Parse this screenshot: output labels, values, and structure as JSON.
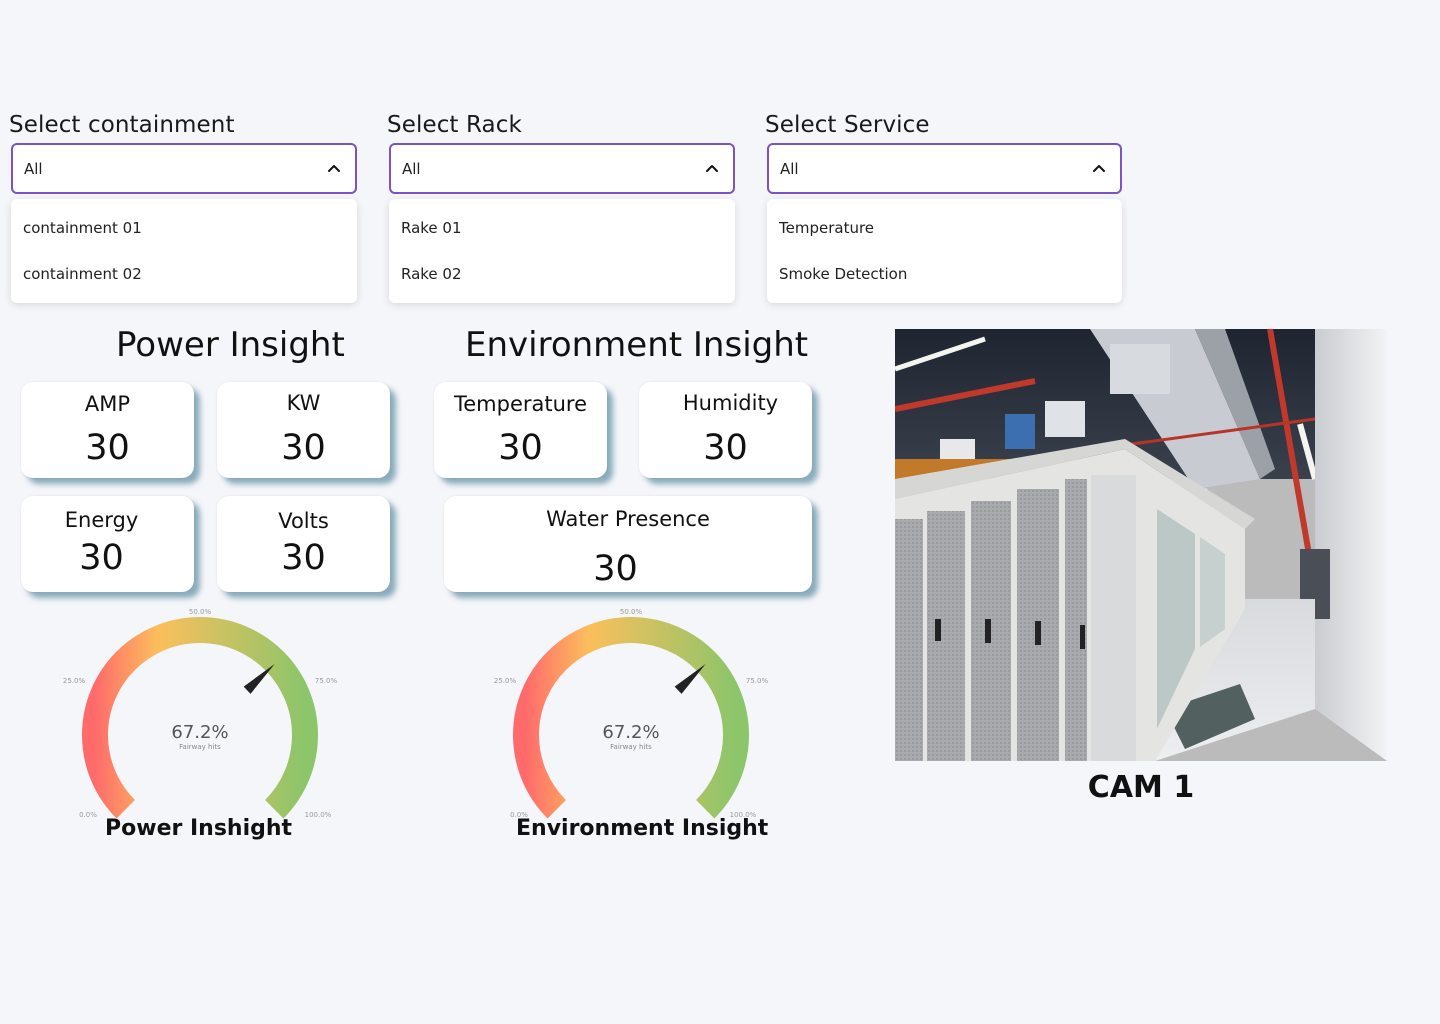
{
  "filters": [
    {
      "label": "Select containment",
      "value": "All",
      "options": [
        "containment 01",
        "containment 02"
      ]
    },
    {
      "label": "Select Rack",
      "value": "All",
      "options": [
        "Rake 01",
        "Rake 02"
      ]
    },
    {
      "label": "Select Service",
      "value": "All",
      "options": [
        "Temperature",
        "Smoke Detection"
      ]
    }
  ],
  "power": {
    "title": "Power Insight",
    "cards": [
      {
        "label": "AMP",
        "value": "30"
      },
      {
        "label": "KW",
        "value": "30"
      },
      {
        "label": "Energy",
        "value": "30"
      },
      {
        "label": "Volts",
        "value": "30"
      }
    ]
  },
  "environment": {
    "title": "Environment Insight",
    "cards": [
      {
        "label": "Temperature",
        "value": "30"
      },
      {
        "label": "Humidity",
        "value": "30"
      },
      {
        "label": "Water Presence",
        "value": "30"
      }
    ]
  },
  "gauges": [
    {
      "caption": "Power Inshight",
      "value_text": "67.2%",
      "sub_label": "Fairway hits",
      "value_fraction": 0.672,
      "ticks": {
        "t0": "0.0%",
        "t25": "25.0%",
        "t50": "50.0%",
        "t75": "75.0%",
        "t100": "100.0%"
      }
    },
    {
      "caption": "Environment Insight",
      "value_text": "67.2%",
      "sub_label": "Fairway hits",
      "value_fraction": 0.672,
      "ticks": {
        "t0": "0.0%",
        "t25": "25.0%",
        "t50": "50.0%",
        "t75": "75.0%",
        "t100": "100.0%"
      }
    }
  ],
  "camera": {
    "caption": "CAM 1"
  },
  "colors": {
    "accent": "#7b52c7",
    "card_shadow": "#32708a",
    "gauge_low": "#ff6b6b",
    "gauge_mid": "#fbbf5c",
    "gauge_high": "#8cc56a"
  }
}
